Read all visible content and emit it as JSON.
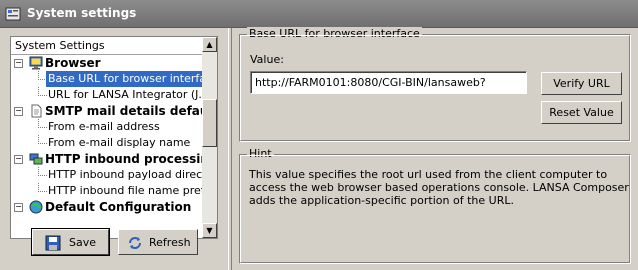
{
  "window": {
    "title": "System settings"
  },
  "tree": {
    "header": "System Settings",
    "rows": [
      {
        "label": "Browser",
        "kind": "group",
        "icon": "monitor-icon"
      },
      {
        "label": "Base URL for browser interface",
        "kind": "child",
        "selected": true
      },
      {
        "label": "URL for LANSA Integrator (J...",
        "kind": "child"
      },
      {
        "label": "SMTP mail details defaults",
        "kind": "group",
        "icon": "document-icon"
      },
      {
        "label": "From e-mail address",
        "kind": "child"
      },
      {
        "label": "From e-mail display name",
        "kind": "child"
      },
      {
        "label": "HTTP inbound processing",
        "kind": "group",
        "icon": "network-icon"
      },
      {
        "label": "HTTP inbound payload direct...",
        "kind": "child"
      },
      {
        "label": "HTTP inbound file name prefix",
        "kind": "child"
      },
      {
        "label": "Default Configuration",
        "kind": "group",
        "icon": "globe-icon"
      }
    ]
  },
  "buttons": {
    "save": "Save",
    "refresh": "Refresh",
    "verify_url": "Verify URL",
    "reset_value": "Reset Value"
  },
  "settings_group": {
    "title": "Base URL for browser interface",
    "value_label": "Value:",
    "value": "http://FARM0101:8080/CGI-BIN/lansaweb?"
  },
  "hint": {
    "title": "Hint",
    "text": "This value specifies the root url used from the client computer to access the web browser based operations console. LANSA Composer adds the application-specific portion of the URL."
  },
  "colors": {
    "selection": "#316ac5",
    "titlebar": "#7a7a7a",
    "face": "#d4d0c8"
  }
}
